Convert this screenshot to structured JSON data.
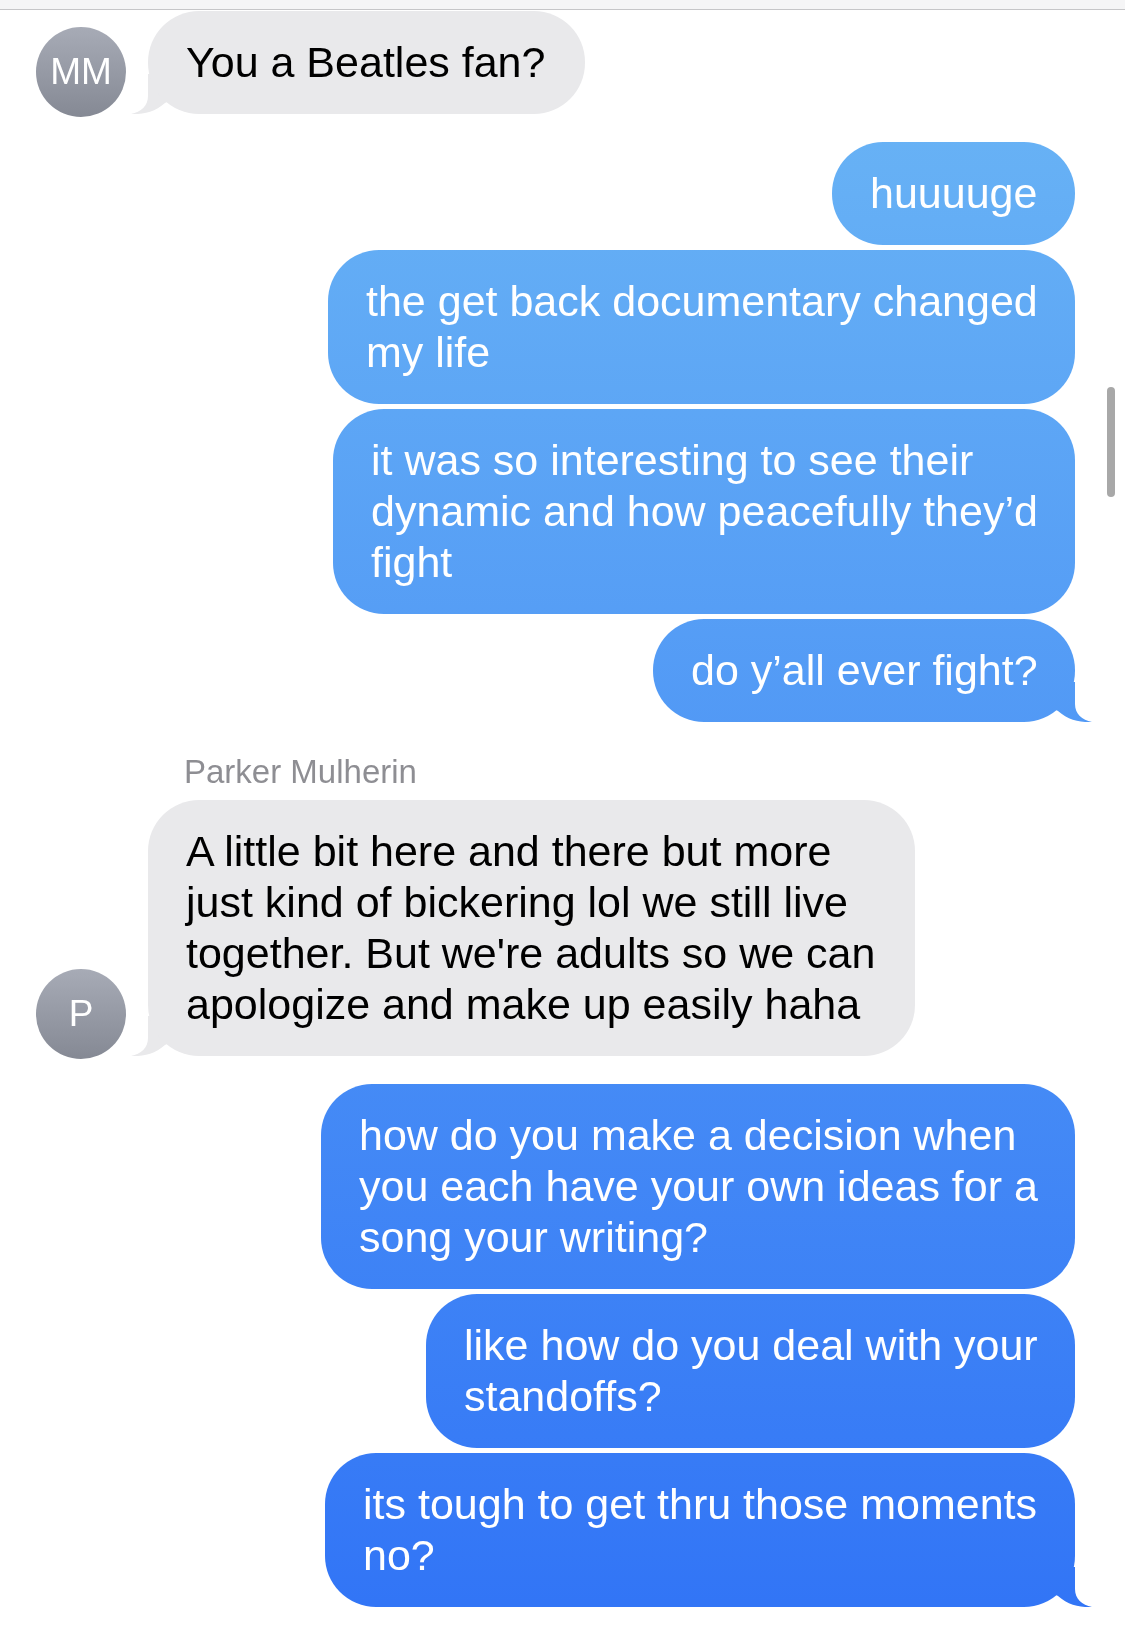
{
  "groups": [
    {
      "kind": "received",
      "avatar": "MM",
      "messages": [
        "You a Beatles fan?"
      ]
    },
    {
      "kind": "sent",
      "messages": [
        "huuuuge",
        "the get back documentary changed my life",
        "it was so interesting to see their dynamic and how peacefully they’d fight",
        "do y’all ever fight?"
      ]
    },
    {
      "kind": "received",
      "sender": "Parker Mulherin",
      "avatar": "P",
      "messages": [
        "A little bit here and there but more just kind of bickering lol we still live together. But we're adults so we can apologize and make up easily haha"
      ]
    },
    {
      "kind": "sent",
      "messages": [
        "how do you make a decision when you each have your own ideas for a song your writing?",
        "like how do you deal with your standoffs?",
        "its tough to get thru those moments no?"
      ]
    }
  ]
}
